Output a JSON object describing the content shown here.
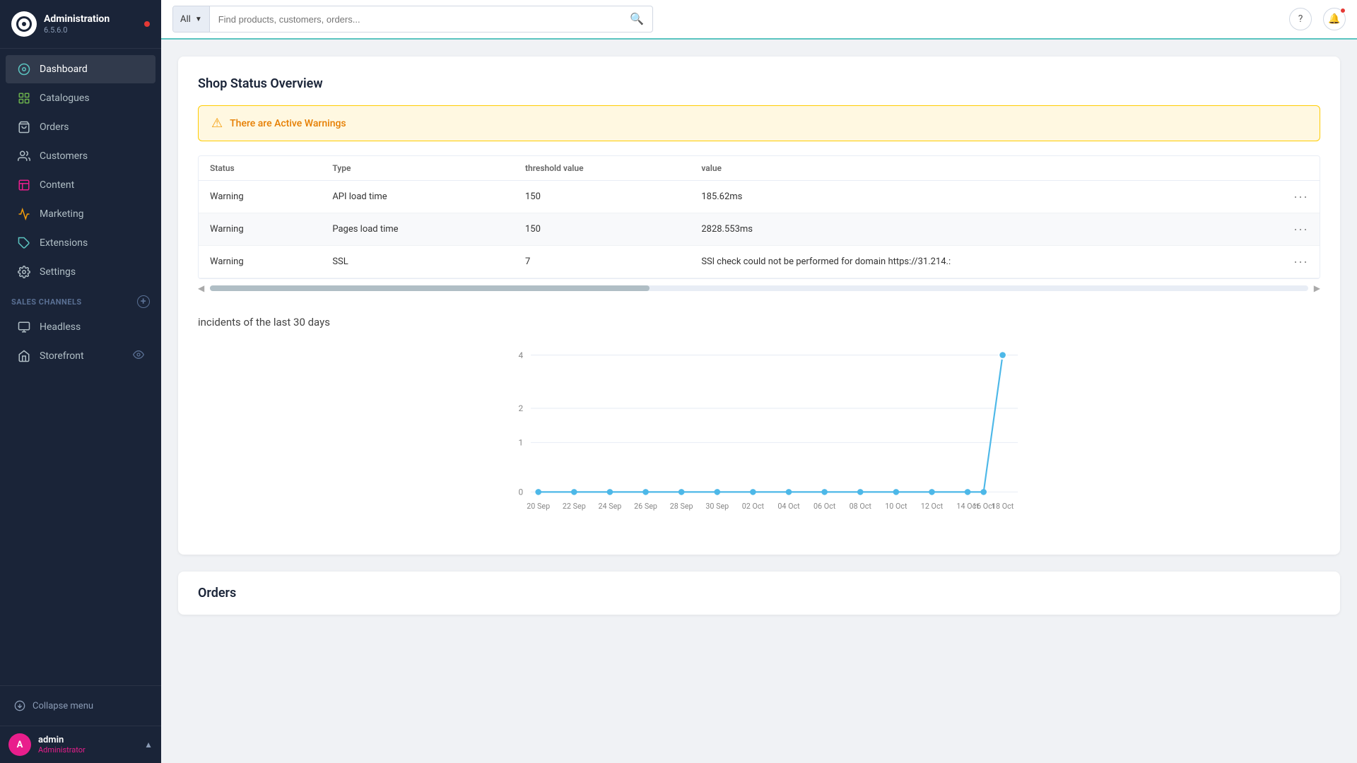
{
  "app": {
    "title": "Administration",
    "version": "6.5.6.0"
  },
  "topbar": {
    "search_filter_label": "All",
    "search_placeholder": "Find products, customers, orders..."
  },
  "sidebar": {
    "nav_items": [
      {
        "id": "dashboard",
        "label": "Dashboard",
        "active": true,
        "icon": "dashboard"
      },
      {
        "id": "catalogues",
        "label": "Catalogues",
        "active": false,
        "icon": "catalogues"
      },
      {
        "id": "orders",
        "label": "Orders",
        "active": false,
        "icon": "orders"
      },
      {
        "id": "customers",
        "label": "Customers",
        "active": false,
        "icon": "customers"
      },
      {
        "id": "content",
        "label": "Content",
        "active": false,
        "icon": "content"
      },
      {
        "id": "marketing",
        "label": "Marketing",
        "active": false,
        "icon": "marketing"
      },
      {
        "id": "extensions",
        "label": "Extensions",
        "active": false,
        "icon": "extensions"
      },
      {
        "id": "settings",
        "label": "Settings",
        "active": false,
        "icon": "settings"
      }
    ],
    "sales_channels_title": "Sales Channels",
    "sales_channels": [
      {
        "id": "headless",
        "label": "Headless",
        "icon": "headless"
      },
      {
        "id": "storefront",
        "label": "Storefront",
        "icon": "storefront",
        "has_eye": true
      }
    ],
    "collapse_label": "Collapse menu",
    "user": {
      "initials": "A",
      "name": "admin",
      "role": "Administrator"
    }
  },
  "main": {
    "card_title": "Shop Status Overview",
    "warning_text": "There are Active Warnings",
    "table": {
      "headers": [
        "Status",
        "Type",
        "threshold value",
        "value"
      ],
      "rows": [
        {
          "status": "Warning",
          "type": "API load time",
          "threshold": "150",
          "value": "185.62ms"
        },
        {
          "status": "Warning",
          "type": "Pages load time",
          "threshold": "150",
          "value": "2828.553ms"
        },
        {
          "status": "Warning",
          "type": "SSL",
          "threshold": "7",
          "value": "SSl check could not be performed for domain https://31.214.:"
        }
      ]
    },
    "chart_title": "incidents of the last 30 days",
    "chart": {
      "y_labels": [
        "4",
        "2",
        "1",
        "0"
      ],
      "x_labels": [
        "20 Sep",
        "22 Sep",
        "24 Sep",
        "26 Sep",
        "28 Sep",
        "30 Sep",
        "02 Oct",
        "04 Oct",
        "06 Oct",
        "08 Oct",
        "10 Oct",
        "12 Oct",
        "14 Oct",
        "16 Oct",
        "18 Oct"
      ]
    },
    "orders_section_title": "Orders"
  }
}
